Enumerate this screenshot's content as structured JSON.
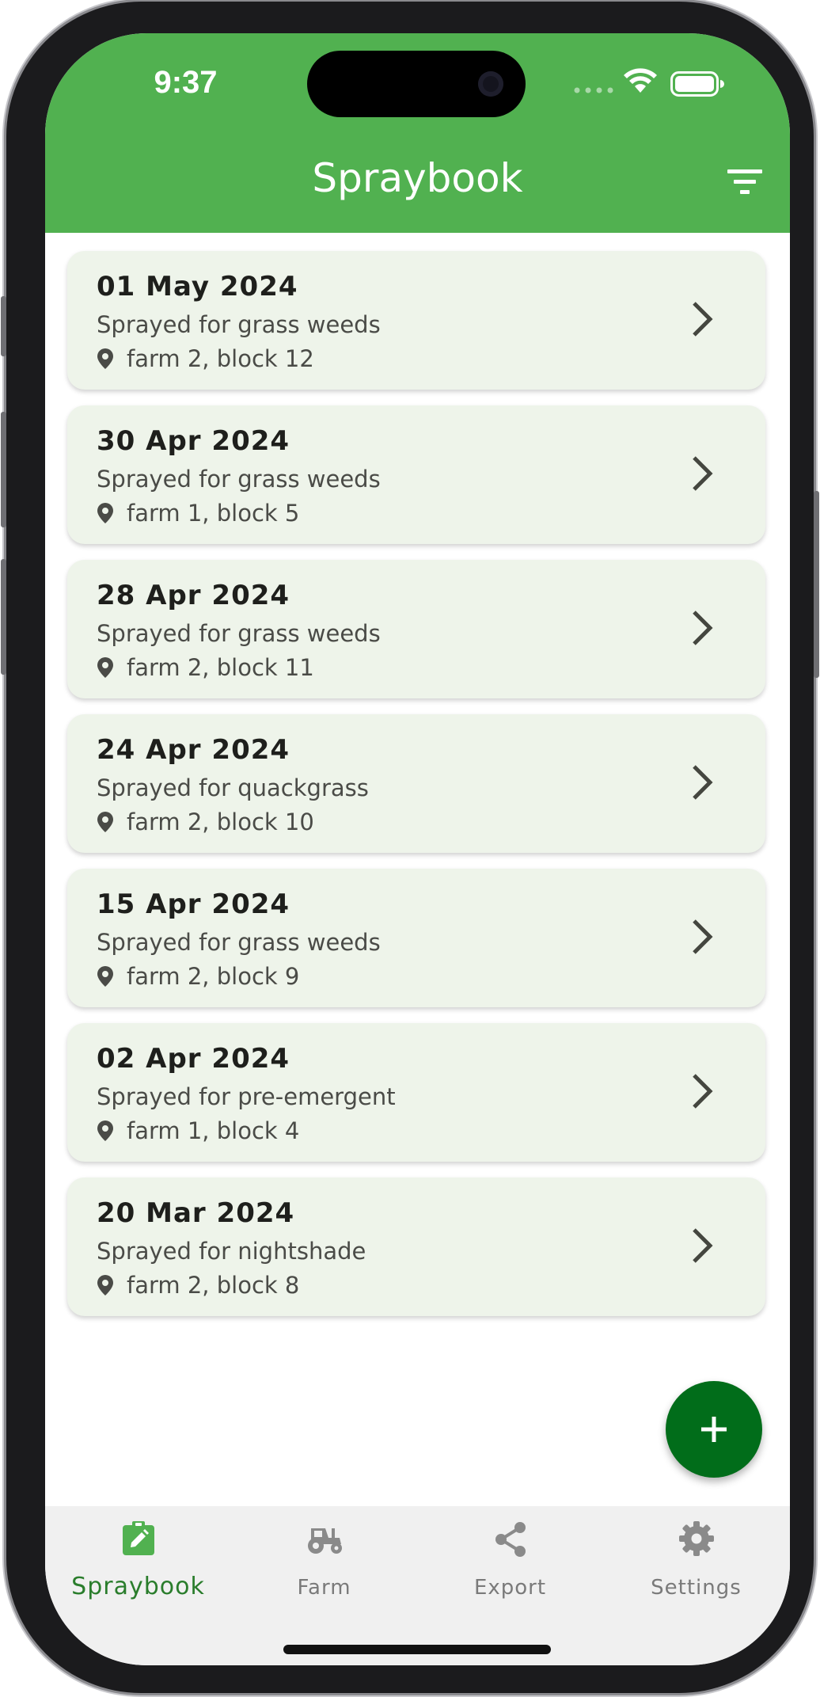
{
  "status_bar": {
    "time": "9:37"
  },
  "header": {
    "title": "Spraybook",
    "background_color": "#51b150"
  },
  "records": [
    {
      "date": "01 May 2024",
      "description": "Sprayed for grass weeds",
      "location": "farm 2, block 12"
    },
    {
      "date": "30 Apr 2024",
      "description": "Sprayed for grass weeds",
      "location": "farm 1, block 5"
    },
    {
      "date": "28 Apr 2024",
      "description": "Sprayed for grass weeds",
      "location": "farm 2, block 11"
    },
    {
      "date": "24 Apr 2024",
      "description": "Sprayed for quackgrass",
      "location": "farm 2, block 10"
    },
    {
      "date": "15 Apr 2024",
      "description": "Sprayed for grass weeds",
      "location": "farm 2, block 9"
    },
    {
      "date": "02 Apr 2024",
      "description": "Sprayed for pre-emergent",
      "location": "farm 1, block 4"
    },
    {
      "date": "20 Mar 2024",
      "description": "Sprayed for nightshade",
      "location": "farm 2, block 8"
    }
  ],
  "fab": {
    "icon": "plus-icon",
    "color": "#016d1a"
  },
  "bottom_nav": {
    "items": [
      {
        "label": "Spraybook",
        "icon": "clipboard-edit-icon",
        "active": true
      },
      {
        "label": "Farm",
        "icon": "tractor-icon",
        "active": false
      },
      {
        "label": "Export",
        "icon": "share-icon",
        "active": false
      },
      {
        "label": "Settings",
        "icon": "gear-icon",
        "active": false
      }
    ],
    "active_color": "#2a7d2c"
  }
}
